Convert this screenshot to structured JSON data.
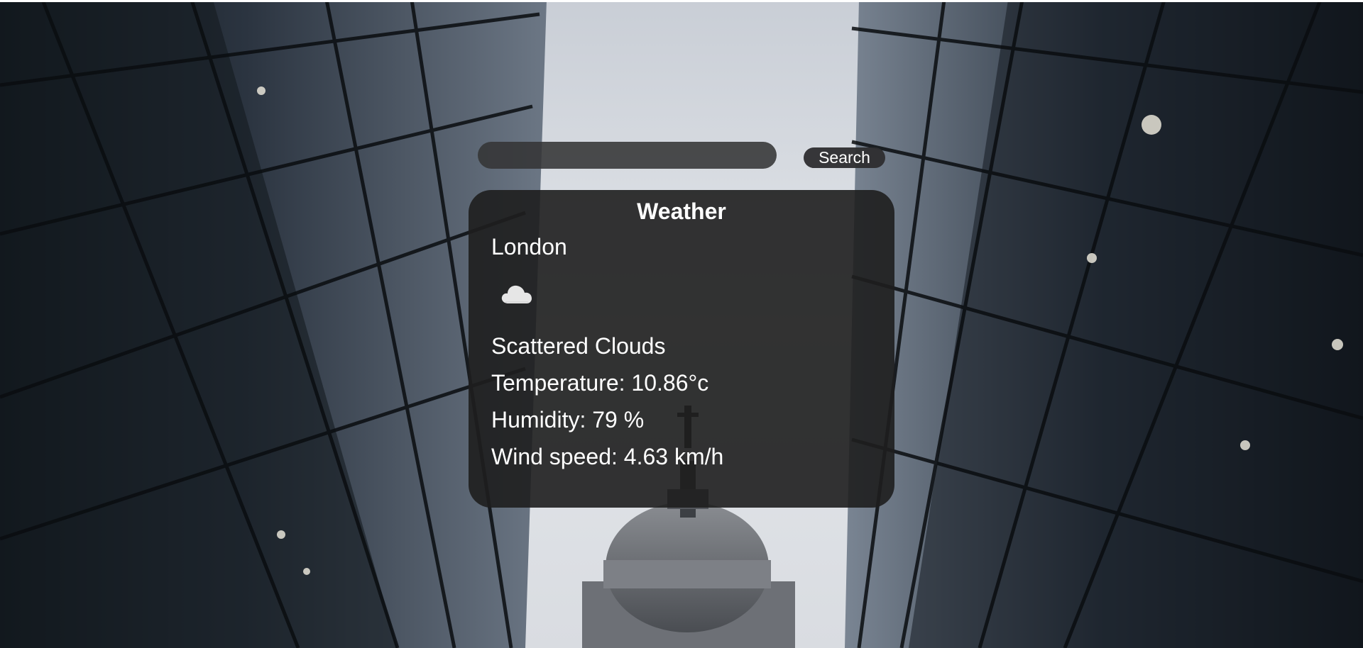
{
  "search": {
    "placeholder": "",
    "value": "",
    "button_label": "Search"
  },
  "card": {
    "title": "Weather",
    "city": "London",
    "icon": "cloud-icon",
    "description": "Scattered Clouds",
    "temperature": "Temperature: 10.86°c",
    "humidity": "Humidity: 79 %",
    "wind": "Wind speed: 4.63 km/h"
  },
  "colors": {
    "card_bg": "#1e1e1e",
    "text": "#ffffff",
    "input_bg": "#343436",
    "button_bg": "#2d2d2f"
  }
}
